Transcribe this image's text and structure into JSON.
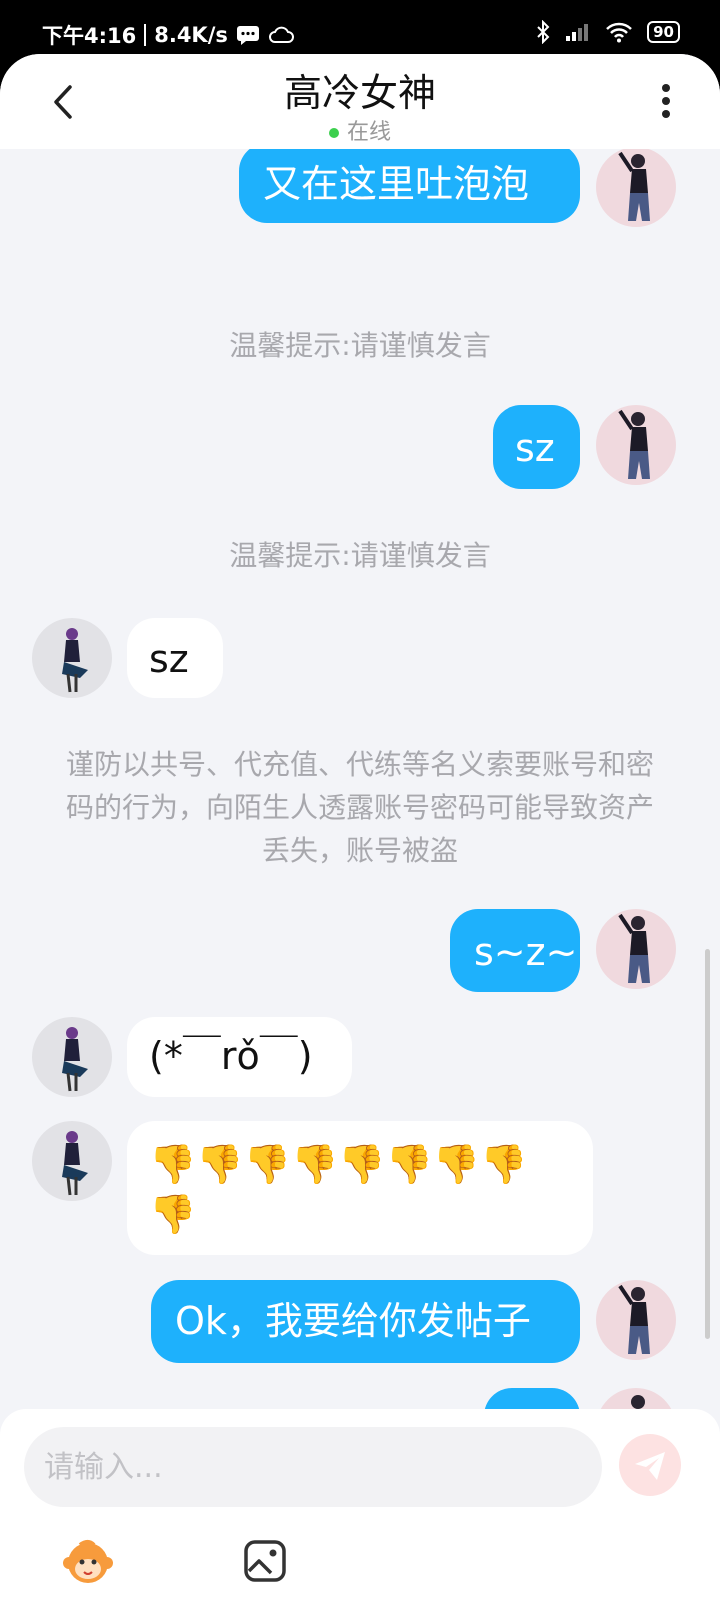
{
  "status_bar": {
    "time": "下午4:16",
    "network_speed": "8.4K/s",
    "battery": "90"
  },
  "header": {
    "title": "高冷女神",
    "status": "在线",
    "status_color": "#3ccf4e"
  },
  "messages": {
    "m1": "又在这里吐泡泡",
    "notice1": "温馨提示:请谨慎发言",
    "m2": "sz",
    "notice2": "温馨提示:请谨慎发言",
    "m3": "sz",
    "notice3": "谨防以共号、代充值、代练等名义索要账号和密码的行为，向陌生人透露账号密码可能导致资产丢失，账号被盗",
    "m4": "s~z~",
    "m5": "(*￣rǒ￣)",
    "m6_line1": "👎👎👎👎👎👎👎👎",
    "m6_line2": "👎",
    "m7": "Ok，我要给你发帖子"
  },
  "composer": {
    "placeholder": "请输入...",
    "send_icon": "send-icon",
    "emoji_icon": "monkey-emoji-icon",
    "image_icon": "image-icon"
  },
  "colors": {
    "outgoing_bubble": "#1eb1fc",
    "incoming_bubble": "#ffffff",
    "background": "#f3f4f8"
  }
}
